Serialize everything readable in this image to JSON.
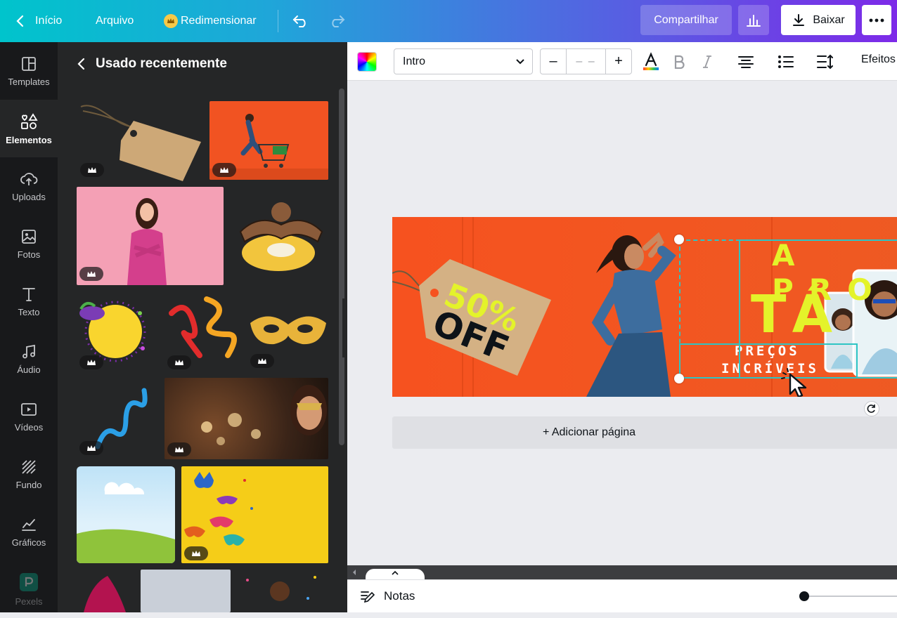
{
  "topbar": {
    "home_label": "Início",
    "file_label": "Arquivo",
    "resize_label": "Redimensionar",
    "share_label": "Compartilhar",
    "download_label": "Baixar"
  },
  "rail": {
    "items": [
      {
        "label": "Templates"
      },
      {
        "label": "Elementos"
      },
      {
        "label": "Uploads"
      },
      {
        "label": "Fotos"
      },
      {
        "label": "Texto"
      },
      {
        "label": "Áudio"
      },
      {
        "label": "Vídeos"
      },
      {
        "label": "Fundo"
      },
      {
        "label": "Gráficos"
      },
      {
        "label": "Pexels"
      }
    ]
  },
  "panel": {
    "title": "Usado recentemente"
  },
  "toolbar": {
    "font_name": "Intro",
    "font_size": "– –",
    "effects_label": "Efeitos"
  },
  "design": {
    "tag_percent": "50%",
    "tag_off": "OFF",
    "headline_1": "A PRO",
    "headline_2": "TÁ",
    "sub_1": "PREÇOS",
    "sub_2": "INCRÍVEIS"
  },
  "canvas": {
    "add_page_label": "+ Adicionar página"
  },
  "bottom": {
    "notes_label": "Notas"
  },
  "colors": {
    "accent_gradient_start": "#00c4cc",
    "accent_gradient_end": "#7d2ae8",
    "banner_orange": "#f6521f",
    "headline_yellow": "#e4f32a",
    "selection_teal": "#2ec4c4"
  }
}
